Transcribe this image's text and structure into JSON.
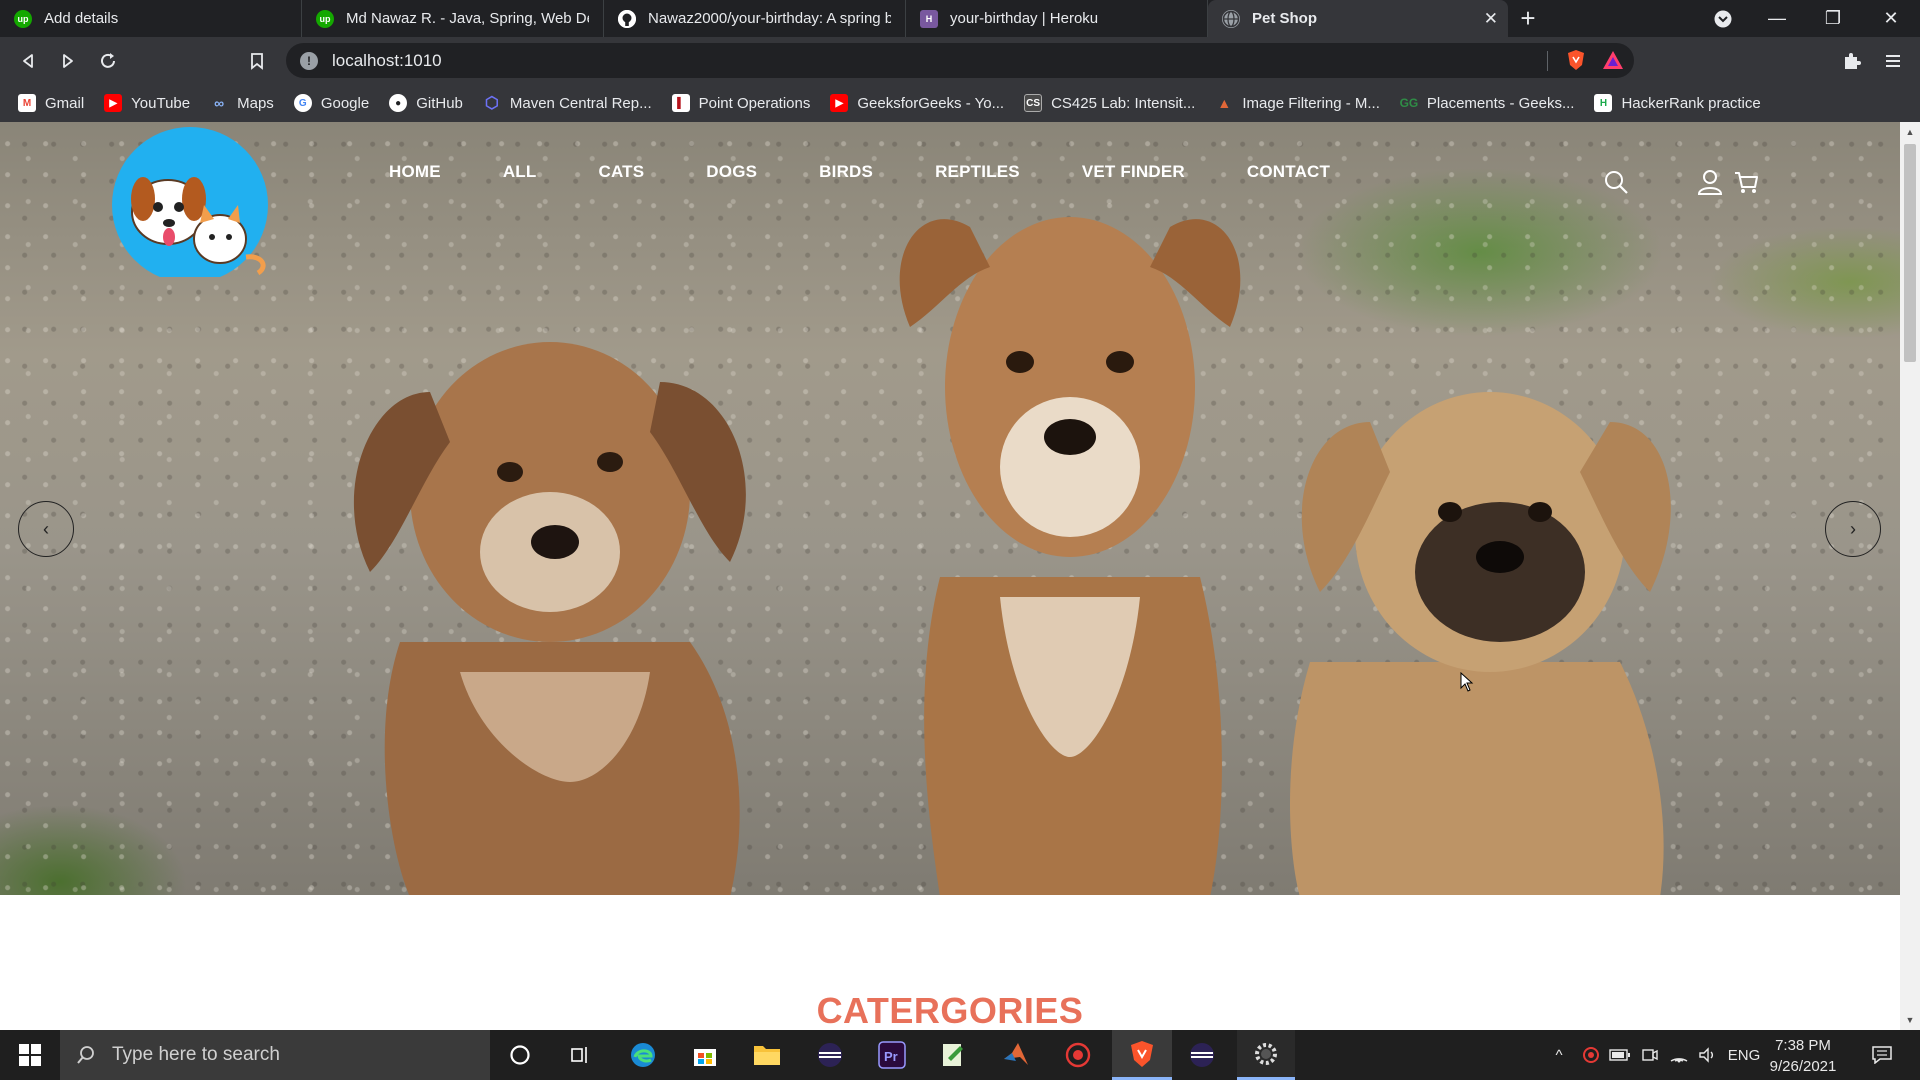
{
  "tabs": [
    {
      "title": "Add details",
      "favicon": "upwork-icon"
    },
    {
      "title": "Md Nawaz R. - Java, Spring, Web Deve",
      "favicon": "upwork-icon"
    },
    {
      "title": "Nawaz2000/your-birthday: A spring b",
      "favicon": "github-icon"
    },
    {
      "title": "your-birthday | Heroku",
      "favicon": "heroku-icon"
    },
    {
      "title": "Pet Shop",
      "favicon": "globe-icon",
      "active": true
    }
  ],
  "address_bar": {
    "url": "localhost:1010"
  },
  "bookmarks": [
    {
      "label": "Gmail",
      "icon": "gmail-icon"
    },
    {
      "label": "YouTube",
      "icon": "youtube-icon"
    },
    {
      "label": "Maps",
      "icon": "maps-icon"
    },
    {
      "label": "Google",
      "icon": "google-icon"
    },
    {
      "label": "GitHub",
      "icon": "github-icon"
    },
    {
      "label": "Maven Central Rep...",
      "icon": "maven-icon"
    },
    {
      "label": "Point Operations",
      "icon": "bookmark-icon"
    },
    {
      "label": "GeeksforGeeks - Yo...",
      "icon": "youtube-icon"
    },
    {
      "label": "CS425 Lab: Intensit...",
      "icon": "cs-icon"
    },
    {
      "label": "Image Filtering - M...",
      "icon": "matlab-icon"
    },
    {
      "label": "Placements - Geeks...",
      "icon": "gfg-icon"
    },
    {
      "label": "HackerRank practice",
      "icon": "hackerrank-icon"
    }
  ],
  "site": {
    "nav": [
      "HOME",
      "ALL",
      "CATS",
      "DOGS",
      "BIRDS",
      "REPTILES",
      "VET FINDER",
      "CONTACT"
    ],
    "hero_prev": "‹",
    "hero_next": "›",
    "section_title": "CATERGORIES"
  },
  "taskbar": {
    "search_placeholder": "Type here to search",
    "language": "ENG",
    "time": "7:38 PM",
    "date": "9/26/2021"
  },
  "colors": {
    "accent_title": "#e8715a",
    "browser_dark": "#202124",
    "browser_toolbar": "#35363a"
  }
}
